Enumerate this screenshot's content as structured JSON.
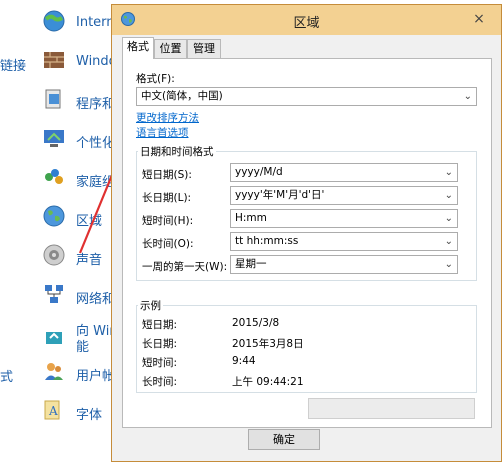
{
  "background": {
    "items": [
      {
        "left_cut": "",
        "label": "Intern",
        "icon": "internet-options-icon"
      },
      {
        "left_cut": "链接",
        "label": "Windo",
        "icon": "windows-firewall-icon"
      },
      {
        "left_cut": "",
        "label": "程序和",
        "icon": "programs-icon"
      },
      {
        "left_cut": "",
        "label": "个性化",
        "icon": "personalization-icon"
      },
      {
        "left_cut": "",
        "label": "家庭组",
        "icon": "homegroup-icon"
      },
      {
        "left_cut": "",
        "label": "区域",
        "icon": "region-icon"
      },
      {
        "left_cut": "",
        "label": "声音",
        "icon": "sound-icon"
      },
      {
        "left_cut": "",
        "label": "网络和",
        "icon": "network-icon"
      },
      {
        "left_cut": "",
        "label": "向 Wir",
        "label2": "能",
        "icon": "windows-to-go-icon"
      },
      {
        "left_cut": "式",
        "label": "用户帐",
        "icon": "user-accounts-icon"
      },
      {
        "left_cut": "",
        "label": "字体",
        "icon": "fonts-icon"
      }
    ],
    "arrow_color": "#e03030"
  },
  "dialog": {
    "title": "区域",
    "close": "×",
    "tabs": [
      "格式",
      "位置",
      "管理"
    ],
    "format_label": "格式(F):",
    "format_value": "中文(简体，中国)",
    "link_sort": "更改排序方法",
    "link_language": "语言首选项",
    "datetime_group": "日期和时间格式",
    "rows": [
      {
        "label": "短日期(S):",
        "value": "yyyy/M/d"
      },
      {
        "label": "长日期(L):",
        "value": "yyyy'年'M'月'd'日'"
      },
      {
        "label": "短时间(H):",
        "value": "H:mm"
      },
      {
        "label": "长时间(O):",
        "value": "tt hh:mm:ss"
      },
      {
        "label": "一周的第一天(W):",
        "value": "星期一"
      }
    ],
    "example_group": "示例",
    "examples": [
      {
        "label": "短日期:",
        "value": "2015/3/8"
      },
      {
        "label": "长日期:",
        "value": "2015年3月8日"
      },
      {
        "label": "短时间:",
        "value": "9:44"
      },
      {
        "label": "长时间:",
        "value": "上午 09:44:21"
      }
    ],
    "ok_button": "确定",
    "title_bar_color": "#f3d192"
  }
}
